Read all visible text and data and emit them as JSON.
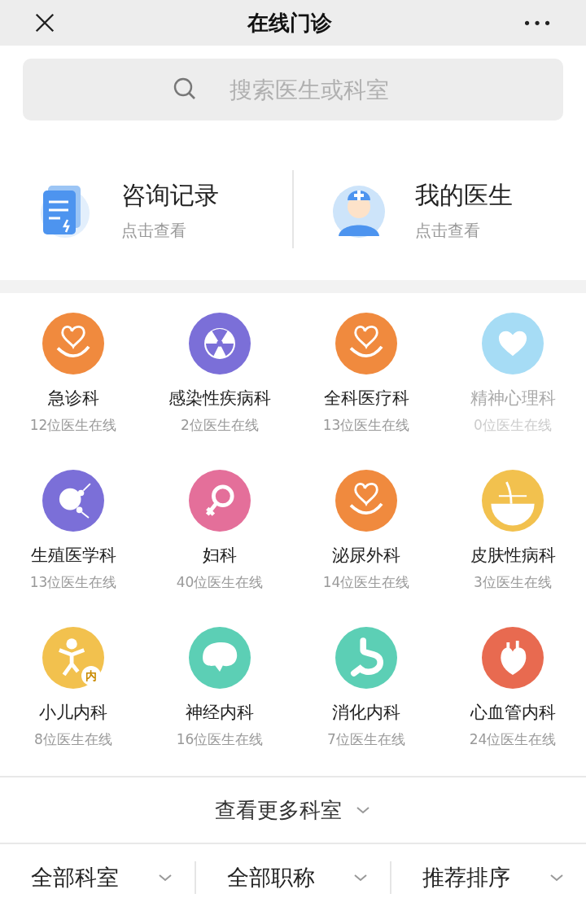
{
  "header": {
    "title": "在线门诊",
    "more": "•••"
  },
  "search": {
    "placeholder": "搜索医生或科室"
  },
  "shortcuts": [
    {
      "kind": "records",
      "title": "咨询记录",
      "subtitle": "点击查看"
    },
    {
      "kind": "doctor",
      "title": "我的医生",
      "subtitle": "点击查看"
    }
  ],
  "departments": [
    {
      "kind": "hand-heart",
      "color": "#f08a3e",
      "name": "急诊科",
      "count": "12位医生在线",
      "disabled": false
    },
    {
      "kind": "radiation",
      "color": "#7b6fd8",
      "name": "感染性疾病科",
      "count": "2位医生在线",
      "disabled": false
    },
    {
      "kind": "hand-heart",
      "color": "#f08a3e",
      "name": "全科医疗科",
      "count": "13位医生在线",
      "disabled": false
    },
    {
      "kind": "heart",
      "color": "#a6dcf5",
      "name": "精神心理科",
      "count": "0位医生在线",
      "disabled": true
    },
    {
      "kind": "sperm",
      "color": "#7b6fd8",
      "name": "生殖医学科",
      "count": "13位医生在线",
      "disabled": false
    },
    {
      "kind": "female",
      "color": "#e46f9a",
      "name": "妇科",
      "count": "40位医生在线",
      "disabled": false
    },
    {
      "kind": "hand-heart",
      "color": "#f08a3e",
      "name": "泌尿外科",
      "count": "14位医生在线",
      "disabled": false
    },
    {
      "kind": "hair",
      "color": "#f2c14e",
      "name": "皮肤性病科",
      "count": "3位医生在线",
      "disabled": false
    },
    {
      "kind": "child",
      "color": "#f2c14e",
      "name": "小儿内科",
      "count": "8位医生在线",
      "disabled": false,
      "badge": "内"
    },
    {
      "kind": "brain",
      "color": "#5ccfb5",
      "name": "神经内科",
      "count": "16位医生在线",
      "disabled": false
    },
    {
      "kind": "stomach",
      "color": "#5ccfb5",
      "name": "消化内科",
      "count": "7位医生在线",
      "disabled": false
    },
    {
      "kind": "organ-heart",
      "color": "#e86a50",
      "name": "心血管内科",
      "count": "24位医生在线",
      "disabled": false
    }
  ],
  "more_link": "查看更多科室",
  "filters": [
    "全部科室",
    "全部职称",
    "推荐排序"
  ]
}
